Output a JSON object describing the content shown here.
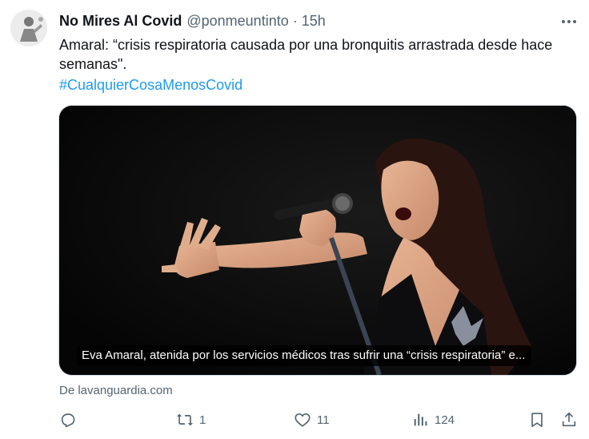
{
  "tweet": {
    "author_name": "No Mires Al Covid",
    "handle": "@ponmeuntinto",
    "separator": "·",
    "time": "15h",
    "text": "Amaral: “crisis respiratoria causada por una bronquitis arrastrada desde hace semanas\".",
    "hashtag": "#CualquierCosaMenosCovid"
  },
  "card": {
    "caption": "Eva Amaral, atenida por los servicios médicos tras sufrir una “crisis respiratoria” e...",
    "source": "De lavanguardia.com"
  },
  "actions": {
    "reply": {
      "icon": "reply-icon",
      "count": ""
    },
    "retweet": {
      "icon": "retweet-icon",
      "count": "1"
    },
    "like": {
      "icon": "heart-icon",
      "count": "11"
    },
    "views": {
      "icon": "views-icon",
      "count": "124"
    },
    "bookmark": {
      "icon": "bookmark-icon"
    },
    "share": {
      "icon": "share-icon"
    }
  },
  "colors": {
    "link": "#1d9bf0",
    "secondary_text": "#536471",
    "primary_text": "#0f1419"
  }
}
